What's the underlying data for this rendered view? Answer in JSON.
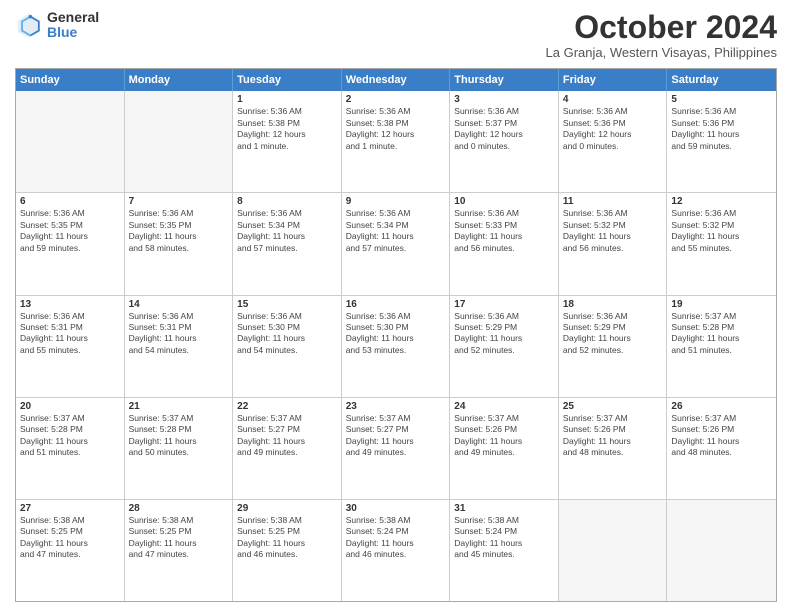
{
  "logo": {
    "general": "General",
    "blue": "Blue"
  },
  "title": "October 2024",
  "location": "La Granja, Western Visayas, Philippines",
  "days_header": [
    "Sunday",
    "Monday",
    "Tuesday",
    "Wednesday",
    "Thursday",
    "Friday",
    "Saturday"
  ],
  "weeks": [
    [
      {
        "day": "",
        "info": ""
      },
      {
        "day": "",
        "info": ""
      },
      {
        "day": "1",
        "info": "Sunrise: 5:36 AM\nSunset: 5:38 PM\nDaylight: 12 hours\nand 1 minute."
      },
      {
        "day": "2",
        "info": "Sunrise: 5:36 AM\nSunset: 5:38 PM\nDaylight: 12 hours\nand 1 minute."
      },
      {
        "day": "3",
        "info": "Sunrise: 5:36 AM\nSunset: 5:37 PM\nDaylight: 12 hours\nand 0 minutes."
      },
      {
        "day": "4",
        "info": "Sunrise: 5:36 AM\nSunset: 5:36 PM\nDaylight: 12 hours\nand 0 minutes."
      },
      {
        "day": "5",
        "info": "Sunrise: 5:36 AM\nSunset: 5:36 PM\nDaylight: 11 hours\nand 59 minutes."
      }
    ],
    [
      {
        "day": "6",
        "info": "Sunrise: 5:36 AM\nSunset: 5:35 PM\nDaylight: 11 hours\nand 59 minutes."
      },
      {
        "day": "7",
        "info": "Sunrise: 5:36 AM\nSunset: 5:35 PM\nDaylight: 11 hours\nand 58 minutes."
      },
      {
        "day": "8",
        "info": "Sunrise: 5:36 AM\nSunset: 5:34 PM\nDaylight: 11 hours\nand 57 minutes."
      },
      {
        "day": "9",
        "info": "Sunrise: 5:36 AM\nSunset: 5:34 PM\nDaylight: 11 hours\nand 57 minutes."
      },
      {
        "day": "10",
        "info": "Sunrise: 5:36 AM\nSunset: 5:33 PM\nDaylight: 11 hours\nand 56 minutes."
      },
      {
        "day": "11",
        "info": "Sunrise: 5:36 AM\nSunset: 5:32 PM\nDaylight: 11 hours\nand 56 minutes."
      },
      {
        "day": "12",
        "info": "Sunrise: 5:36 AM\nSunset: 5:32 PM\nDaylight: 11 hours\nand 55 minutes."
      }
    ],
    [
      {
        "day": "13",
        "info": "Sunrise: 5:36 AM\nSunset: 5:31 PM\nDaylight: 11 hours\nand 55 minutes."
      },
      {
        "day": "14",
        "info": "Sunrise: 5:36 AM\nSunset: 5:31 PM\nDaylight: 11 hours\nand 54 minutes."
      },
      {
        "day": "15",
        "info": "Sunrise: 5:36 AM\nSunset: 5:30 PM\nDaylight: 11 hours\nand 54 minutes."
      },
      {
        "day": "16",
        "info": "Sunrise: 5:36 AM\nSunset: 5:30 PM\nDaylight: 11 hours\nand 53 minutes."
      },
      {
        "day": "17",
        "info": "Sunrise: 5:36 AM\nSunset: 5:29 PM\nDaylight: 11 hours\nand 52 minutes."
      },
      {
        "day": "18",
        "info": "Sunrise: 5:36 AM\nSunset: 5:29 PM\nDaylight: 11 hours\nand 52 minutes."
      },
      {
        "day": "19",
        "info": "Sunrise: 5:37 AM\nSunset: 5:28 PM\nDaylight: 11 hours\nand 51 minutes."
      }
    ],
    [
      {
        "day": "20",
        "info": "Sunrise: 5:37 AM\nSunset: 5:28 PM\nDaylight: 11 hours\nand 51 minutes."
      },
      {
        "day": "21",
        "info": "Sunrise: 5:37 AM\nSunset: 5:28 PM\nDaylight: 11 hours\nand 50 minutes."
      },
      {
        "day": "22",
        "info": "Sunrise: 5:37 AM\nSunset: 5:27 PM\nDaylight: 11 hours\nand 49 minutes."
      },
      {
        "day": "23",
        "info": "Sunrise: 5:37 AM\nSunset: 5:27 PM\nDaylight: 11 hours\nand 49 minutes."
      },
      {
        "day": "24",
        "info": "Sunrise: 5:37 AM\nSunset: 5:26 PM\nDaylight: 11 hours\nand 49 minutes."
      },
      {
        "day": "25",
        "info": "Sunrise: 5:37 AM\nSunset: 5:26 PM\nDaylight: 11 hours\nand 48 minutes."
      },
      {
        "day": "26",
        "info": "Sunrise: 5:37 AM\nSunset: 5:26 PM\nDaylight: 11 hours\nand 48 minutes."
      }
    ],
    [
      {
        "day": "27",
        "info": "Sunrise: 5:38 AM\nSunset: 5:25 PM\nDaylight: 11 hours\nand 47 minutes."
      },
      {
        "day": "28",
        "info": "Sunrise: 5:38 AM\nSunset: 5:25 PM\nDaylight: 11 hours\nand 47 minutes."
      },
      {
        "day": "29",
        "info": "Sunrise: 5:38 AM\nSunset: 5:25 PM\nDaylight: 11 hours\nand 46 minutes."
      },
      {
        "day": "30",
        "info": "Sunrise: 5:38 AM\nSunset: 5:24 PM\nDaylight: 11 hours\nand 46 minutes."
      },
      {
        "day": "31",
        "info": "Sunrise: 5:38 AM\nSunset: 5:24 PM\nDaylight: 11 hours\nand 45 minutes."
      },
      {
        "day": "",
        "info": ""
      },
      {
        "day": "",
        "info": ""
      }
    ]
  ]
}
